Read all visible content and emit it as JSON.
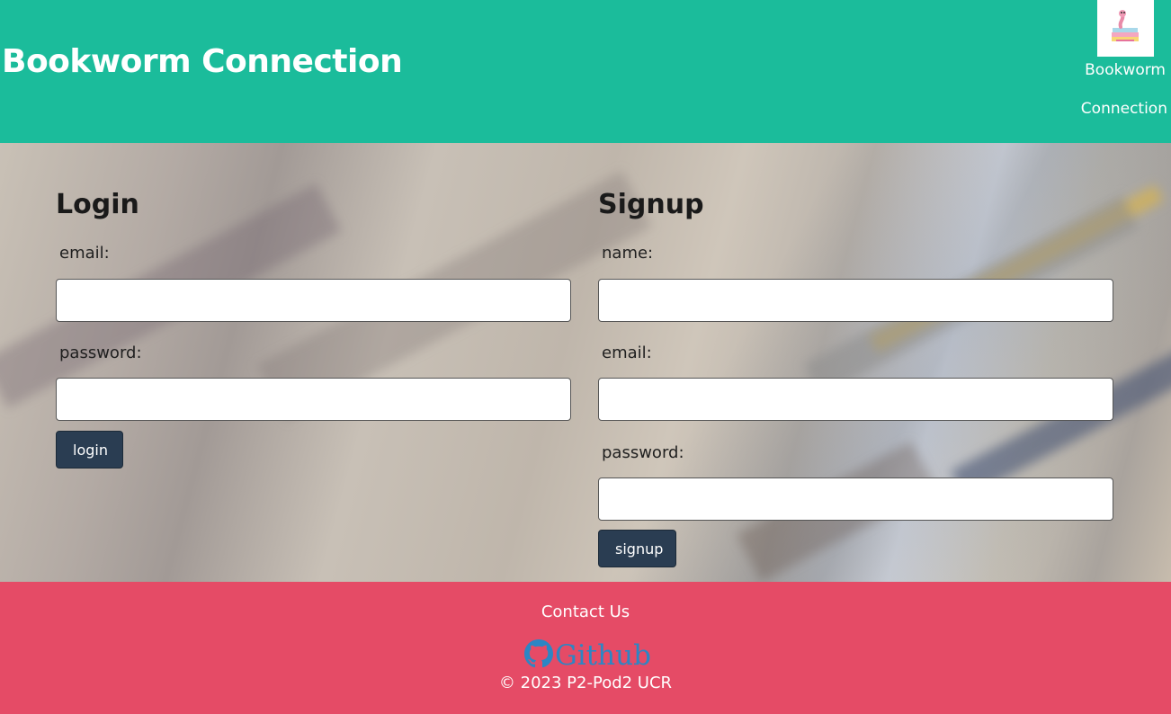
{
  "header": {
    "title": "Bookworm Connection",
    "nav_brand_line1": "Bookworm",
    "nav_brand_line2": "Connection",
    "logo_icon": "bookworm-logo-icon"
  },
  "login": {
    "title": "Login",
    "email_label": "email:",
    "email_value": "",
    "password_label": "password:",
    "password_value": "",
    "button_label": "login"
  },
  "signup": {
    "title": "Signup",
    "name_label": "name:",
    "name_value": "",
    "email_label": "email:",
    "email_value": "",
    "password_label": "password:",
    "password_value": "",
    "button_label": "signup"
  },
  "footer": {
    "contact_label": "Contact Us",
    "github_label": "Github",
    "github_icon": "github-icon",
    "copyright": "© 2023 P2-Pod2 UCR"
  },
  "colors": {
    "header_bg": "#1bbc9b",
    "footer_bg": "#e54b66",
    "button_bg": "#2a3d52",
    "github_link": "#2c86c4"
  }
}
